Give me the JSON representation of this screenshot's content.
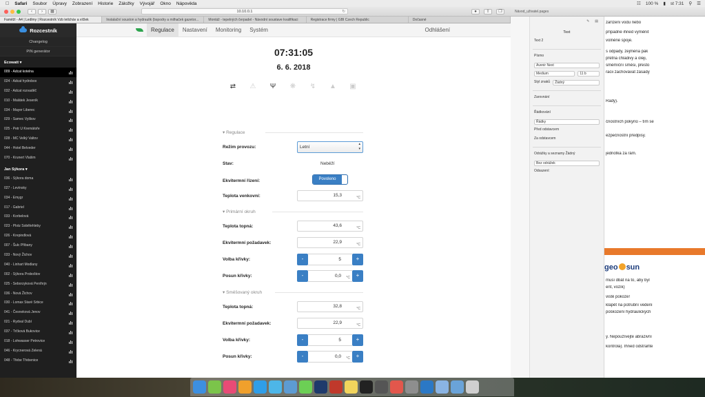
{
  "menubar": {
    "app": "Safari",
    "items": [
      "Soubor",
      "Úpravy",
      "Zobrazení",
      "Historie",
      "Záložky",
      "Vývojář",
      "Okno",
      "Nápověda"
    ],
    "battery": "100 %",
    "clock": "st 7:31"
  },
  "browser": {
    "url": "10.10.0.1",
    "tabs": [
      "Faměží - A4 | Ledlmy | Rozcestník Vzb letlcháv a víčlek",
      "Instalační souston a hydraulik (bspodry a milhaček gazetor...",
      "Montáž - tepelných čerpadel - Návodní soustave kvalifikaci",
      "Registrace firmy | GBI Czech Republic",
      "Dočasné"
    ]
  },
  "sidebar": {
    "brand": "Rozcestník",
    "links": [
      "Changelog",
      "PIN generátor"
    ],
    "groups": [
      {
        "name": "Ecowatt",
        "items": [
          "009 - Adcat kotelna",
          "024 - Adcat hydrobox",
          "032 - Adcat rozvaděč",
          "010 - Malátek Jeseník",
          "034 - Mayer Liberec",
          "029 - Samec Vyškov",
          "025 - Petr U Kremátoře",
          "028 - MC Velký Valtov",
          "044 - Hotel Belveder",
          "070 - Krunert Vlašim"
        ]
      },
      {
        "name": "Jan Sýkora",
        "items": [
          "036 - Sýkora doma",
          "027 - Levínsky",
          "034 - Emygr",
          "017 - Gabriel",
          "033 - Korbelová",
          "023 - Plotz Sobělehleby",
          "026 - Krepindlová",
          "007 - Šulc Přibany",
          "033 - Nový Žichov",
          "040 - Linhart Modlany",
          "002 - Sýkora Proboštov",
          "025 - Seborzyková Peníhrjn",
          "036 - Nová Žichov",
          "030 - Lomax Staré Srbice",
          "041 - Česneková Jenov",
          "021 - Rydval Dubí",
          "037 - Trčková Bukovice",
          "018 - Lohwasser Petrovice",
          "046 - Krycnerová Zelená",
          "048 - Třebe Třebenice"
        ]
      }
    ]
  },
  "nav": {
    "tabs": [
      "Regulace",
      "Nastavení",
      "Monitoring",
      "Systém"
    ],
    "active": "Regulace",
    "logout": "Odhlášení"
  },
  "main": {
    "time": "07:31:05",
    "date": "6. 6. 2018",
    "status_icons": [
      "swap-arrows-icon",
      "warning-icon",
      "antenna-icon",
      "fan-icon",
      "flash-icon",
      "building-icon",
      "lock-icon"
    ],
    "sections": {
      "regulation": "Regulace",
      "primary": "Primární okruh",
      "mixed": "Směšovaný okruh"
    },
    "rezim_label": "Režim provozu:",
    "rezim_value": "Letní",
    "stav_label": "Stav:",
    "stav_value": "Neběží",
    "ekv_label": "Ekvitermní řízení:",
    "ekv_value": "Povoleno",
    "venk_label": "Teplota venkovní:",
    "venk_value": "15,3",
    "unit": "°C",
    "prim_topna_label": "Teplota topná:",
    "prim_topna_value": "43,6",
    "prim_ekv_label": "Ekvitermní požadavek:",
    "prim_ekv_value": "22,9",
    "prim_volba_label": "Volba křivky:",
    "prim_volba_value": "5",
    "prim_posun_label": "Posun křivky:",
    "prim_posun_value": "0,0",
    "mix_topna_label": "Teplota topná:",
    "mix_topna_value": "32,8",
    "mix_ekv_label": "Ekvitermní požadavek:",
    "mix_ekv_value": "22,9",
    "mix_volba_label": "Volba křivky:",
    "mix_volba_value": "5",
    "mix_posun_label": "Posun křivky:",
    "mix_posun_value": "0,0",
    "minus": "-",
    "plus": "+"
  },
  "pages": {
    "doc_title": "Návod_uživatel.pages",
    "inspector_tab": "Text",
    "style": "Text 2",
    "font_label": "Písmo",
    "font": "Avenir Next",
    "weight": "Medium",
    "size": "11 b",
    "char_style_label": "Styl znaků",
    "char_style": "Žádný",
    "align_label": "Zarovnání",
    "spacing_label": "Řádkování",
    "spacing": "Řádky",
    "before_label": "Před odstavcem",
    "after_label": "Za odstavcem",
    "bullets_label": "Odrážky a seznamy",
    "bullets": "Žádný",
    "bullet_style": "Bez odrážek",
    "indent_label": "Odsazení:",
    "doc_lines": [
      "zařízení vodu nebo",
      "případné ihned vyměnit",
      "volněné spoje.",
      "s odpady, zejména pak",
      "přetna chladivy a oleji,",
      "smémíční směsi, přesto",
      "racii zachovávat zásady",
      "Rady).",
      "čnostních pokynů – tím se",
      "ezpečnostní předpisy.",
      "jednotka za rám.",
      "musí dbát na to, aby byl",
      "ent, vozík)",
      "vistě pokoze!",
      "klápět na potrubní vedení",
      "poškození hydraulických",
      "y. Nepoužívejte abrazivní",
      "kontrola). Ihned odstraňte"
    ],
    "logo_left": "geo",
    "logo_right": "sun"
  },
  "colors": {
    "accent_blue": "#3a7fc4",
    "brand_green": "#2da44e",
    "sidebar_bg": "#1f1f1f",
    "orange": "#e8792b"
  }
}
